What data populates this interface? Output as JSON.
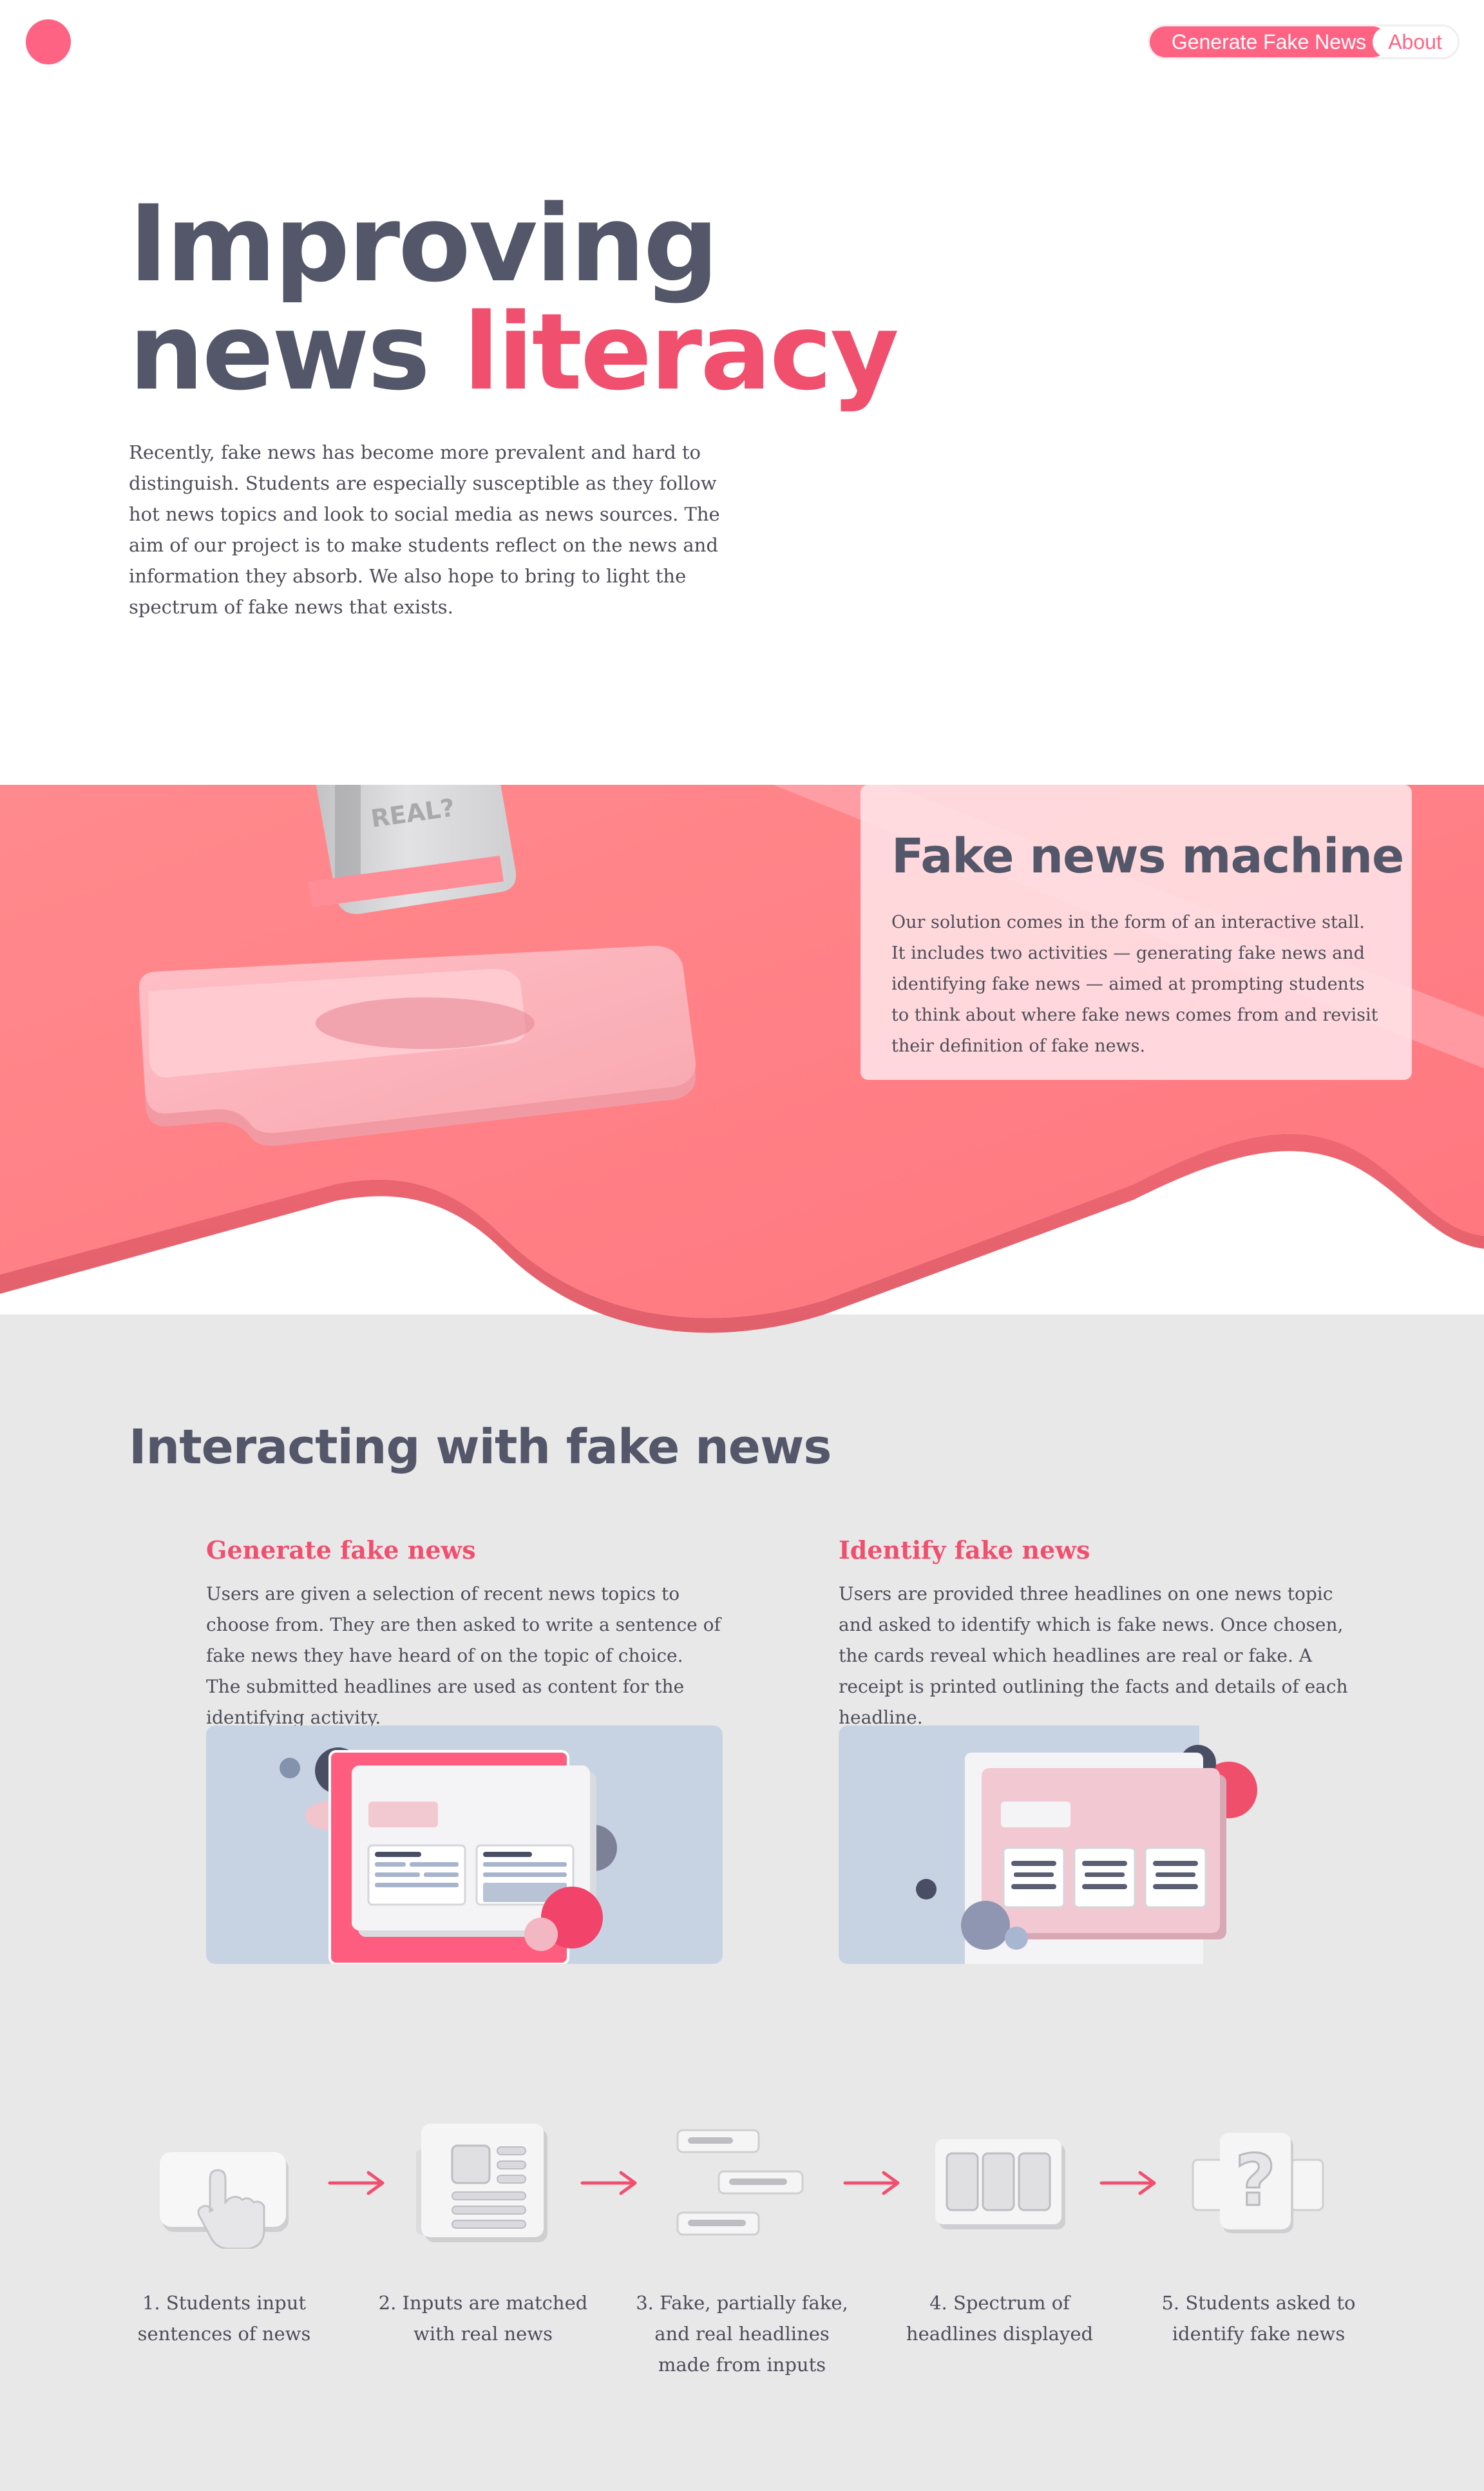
{
  "header": {
    "nav": {
      "generate_label": "Generate Fake News",
      "about_label": "About"
    }
  },
  "hero": {
    "title_line1": "Improving",
    "title_line2_plain": "news",
    "title_line2_accent": "literacy",
    "paragraph": "Recently, fake news has become more prevalent and hard to distinguish. Students are especially susceptible as they follow hot news topics and look to social media as news sources. The aim of our project is to make students reflect on the news and information they absorb. We also hope to bring to light the spectrum of fake news that exists.",
    "stall_label": "REAL?"
  },
  "machine": {
    "title": "Fake news machine",
    "paragraph": "Our solution comes in the form of an interactive stall. It includes two activities — generating fake news and identifying fake news — aimed at prompting students to think about where fake news comes from and revisit their definition of fake news."
  },
  "interacting": {
    "title": "Interacting with fake news",
    "activities": [
      {
        "heading": "Generate fake news",
        "text": "Users are given a selection of recent news topics to choose from. They are then asked to write a sentence of fake news they have heard of on the topic of choice. The submitted headlines are used as content for the identifying activity."
      },
      {
        "heading": "Identify fake news",
        "text": "Users are provided three headlines on one news topic and asked to identify which is fake news. Once chosen, the cards reveal which headlines are real or fake. A receipt is printed outlining the facts and details of each headline."
      }
    ]
  },
  "steps": [
    {
      "label": "1. Students input sentences of news",
      "icon": "touch-hand-icon"
    },
    {
      "label": "2. Inputs are matched with real news",
      "icon": "newspaper-icon"
    },
    {
      "label": "3. Fake, partially fake, and real headlines made from inputs",
      "icon": "headlines-icon"
    },
    {
      "label": "4. Spectrum of headlines displayed",
      "icon": "cards-icon"
    },
    {
      "label": "5. Students asked to identify fake news",
      "icon": "question-icon"
    }
  ],
  "colors": {
    "accent": "#f0506e",
    "brand_pink": "#ff6384",
    "heading_slate": "#535769",
    "band_coral": "#ff8186",
    "section_grey": "#e8e8e9",
    "illustration_blue": "#c7d3e3"
  }
}
